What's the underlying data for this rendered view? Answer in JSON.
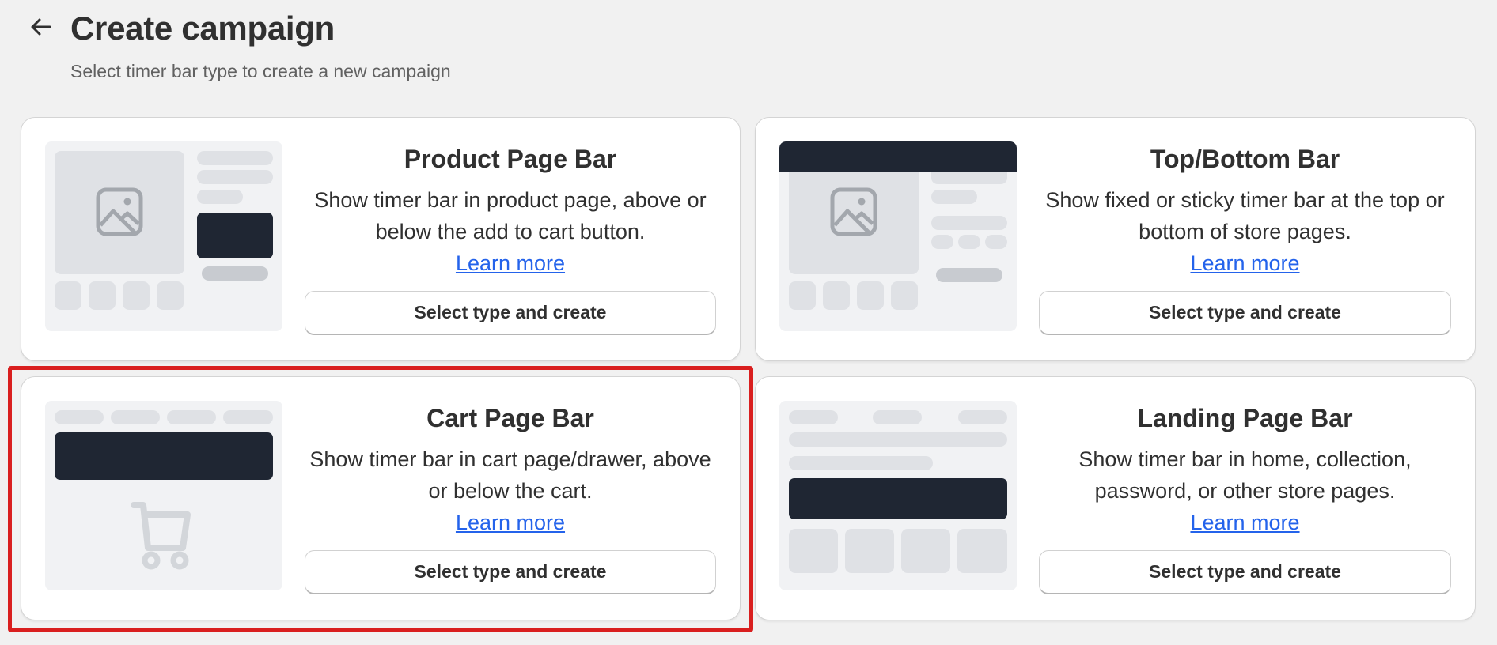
{
  "header": {
    "back_icon": "arrow-left-icon",
    "title": "Create campaign",
    "subtitle": "Select timer bar type to create a new campaign"
  },
  "cards": [
    {
      "title": "Product Page Bar",
      "description": "Show timer bar in product page, above or below the add to cart button.",
      "learn_more": "Learn more",
      "button": "Select type and create",
      "illustration_icon": "image-icon"
    },
    {
      "title": "Top/Bottom Bar",
      "description": "Show fixed or sticky timer bar at the top or bottom of store pages.",
      "learn_more": "Learn more",
      "button": "Select type and create",
      "illustration_icon": "image-icon"
    },
    {
      "title": "Cart Page Bar",
      "description": "Show timer bar in cart page/drawer, above or below the cart.",
      "learn_more": "Learn more",
      "button": "Select type and create",
      "illustration_icon": "cart-icon",
      "highlighted": true
    },
    {
      "title": "Landing Page Bar",
      "description": "Show timer bar in home, collection, password, or other store pages.",
      "learn_more": "Learn more",
      "button": "Select type and create",
      "illustration_icon": "none"
    }
  ],
  "colors": {
    "background": "#f1f1f1",
    "card": "#ffffff",
    "dark_bar": "#1f2633",
    "link": "#2463eb",
    "highlight": "#d91f1f"
  }
}
